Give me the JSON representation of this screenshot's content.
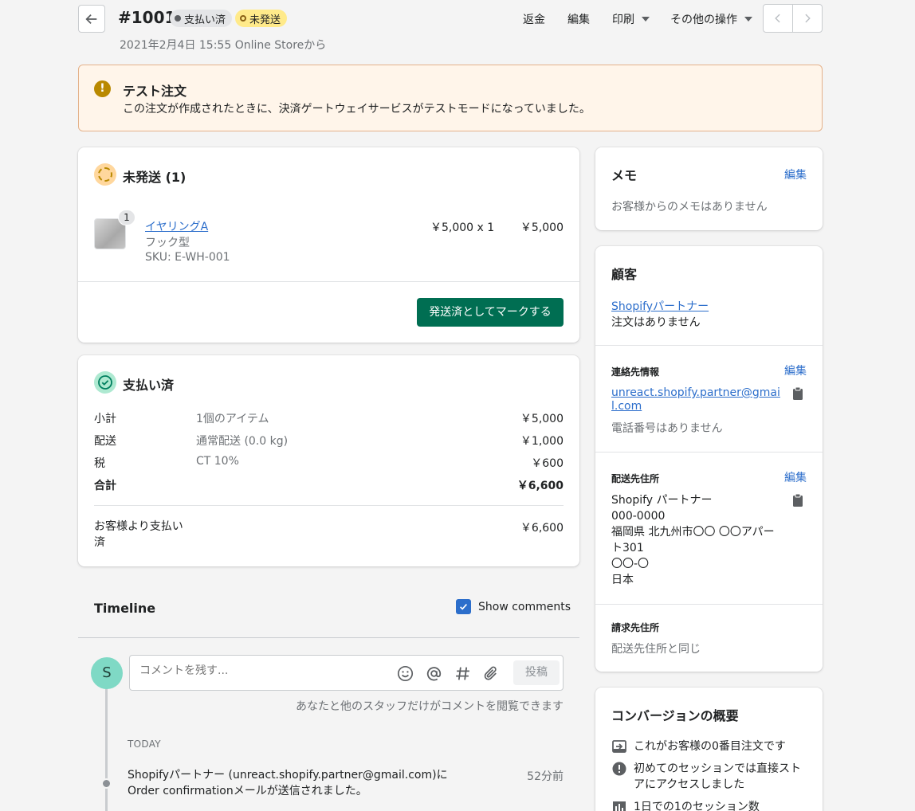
{
  "header": {
    "order_number": "#1001",
    "badge_paid": "支払い済",
    "badge_unfulfilled": "未発送",
    "subtitle": "2021年2月4日 15:55 Online Storeから",
    "actions": {
      "refund": "返金",
      "edit": "編集",
      "print": "印刷",
      "more": "その他の操作"
    }
  },
  "banner": {
    "title": "テスト注文",
    "message": "この注文が作成されたときに、決済ゲートウェイサービスがテストモードになっていました。"
  },
  "fulfillment": {
    "title": "未発送 (1)",
    "item": {
      "quantity_badge": "1",
      "name": "イヤリングA",
      "variant": "フック型",
      "sku": "SKU: E-WH-001",
      "price_qty": "￥5,000 x 1",
      "total": "￥5,000"
    },
    "mark_button": "発送済としてマークする"
  },
  "payment": {
    "title": "支払い済",
    "rows": [
      {
        "label": "小計",
        "desc": "1個のアイテム",
        "amount": "￥5,000"
      },
      {
        "label": "配送",
        "desc": "通常配送 (0.0 kg)",
        "amount": "￥1,000"
      },
      {
        "label": "税",
        "desc": "CT 10%",
        "amount": "￥600"
      },
      {
        "label": "合計",
        "desc": "",
        "amount": "￥6,600"
      }
    ],
    "paid_by_customer_label": "お客様より支払い済",
    "paid_by_customer_amount": "￥6,600"
  },
  "timeline": {
    "title": "Timeline",
    "show_comments": "Show comments",
    "avatar_initial": "S",
    "comment_placeholder": "コメントを残す...",
    "post_button": "投稿",
    "visibility_note": "あなたと他のスタッフだけがコメントを閲覧できます",
    "today_label": "TODAY",
    "event_text": "Shopifyパートナー (unreact.shopify.partner@gmail.com)にOrder confirmationメールが送信されました。",
    "event_time": "52分前"
  },
  "memo": {
    "title": "メモ",
    "edit": "編集",
    "empty": "お客様からのメモはありません"
  },
  "customer": {
    "title": "顧客",
    "name": "Shopifyパートナー",
    "orders": "注文はありません",
    "contact_title": "連絡先情報",
    "contact_edit": "編集",
    "email": "unreact.shopify.partner@gmail.com",
    "phone": "電話番号はありません",
    "shipping_title": "配送先住所",
    "shipping_edit": "編集",
    "shipping_lines": [
      "Shopify パートナー",
      "000-0000",
      "福岡県 北九州市〇〇 〇〇アパート301",
      "〇〇-〇",
      "日本"
    ],
    "billing_title": "請求先住所",
    "billing_same": "配送先住所と同じ"
  },
  "conversion": {
    "title": "コンバージョンの概要",
    "items": [
      "これがお客様の0番目注文です",
      "初めてのセッションでは直接ストアにアクセスしました",
      "1日での1のセッション数"
    ]
  },
  "colors": {
    "primary_button": "#006e52",
    "link": "#2c6ecb",
    "banner_bg": "#fff5ea",
    "banner_border": "#e4b28b",
    "warning_badge": "#ffea8a"
  }
}
